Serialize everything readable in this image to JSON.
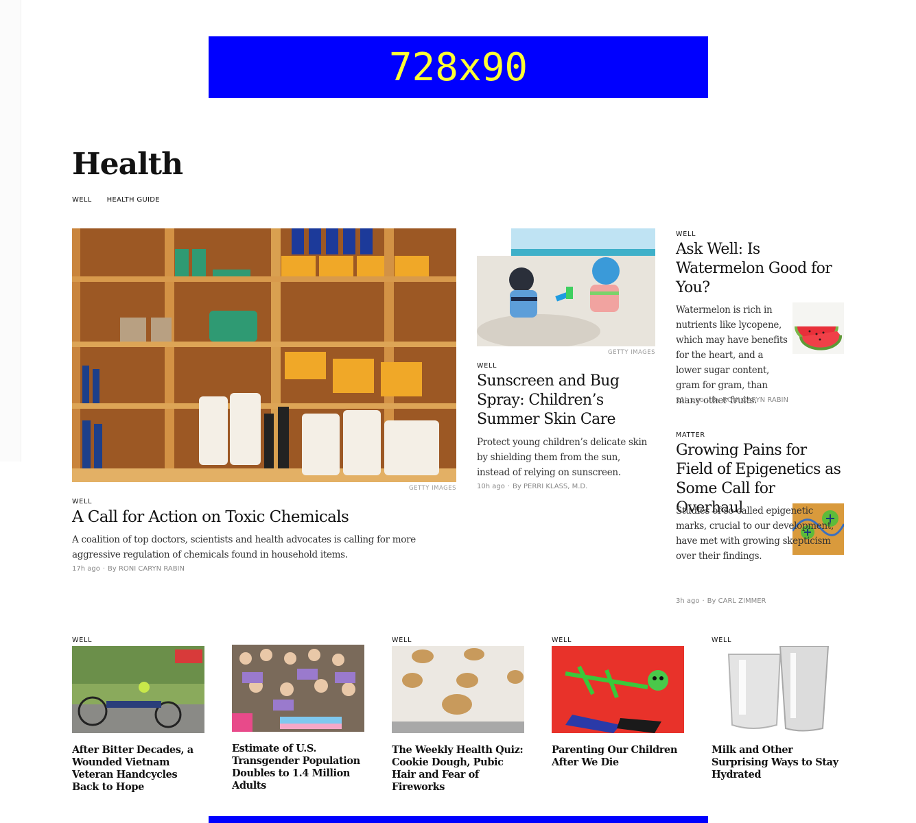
{
  "ads": {
    "top_label": "728x90"
  },
  "section": {
    "title": "Health",
    "subnav": [
      "WELL",
      "HEALTH GUIDE"
    ]
  },
  "lead": {
    "credit": "GETTY IMAGES",
    "kicker": "WELL",
    "headline": "A Call for Action on Toxic Chemicals",
    "summary": "A coalition of top doctors, scientists and health advocates is calling for more aggressive regulation of chemicals found in household items.",
    "time": "17h ago",
    "byline": "By RONI CARYN RABIN"
  },
  "middle": {
    "credit": "GETTY IMAGES",
    "kicker": "WELL",
    "headline": "Sunscreen and Bug Spray: Children’s Summer Skin Care",
    "summary": "Protect young children’s delicate skin by shielding them from the sun, instead of relying on sunscreen.",
    "time": "10h ago",
    "byline": "By PERRI KLASS, M.D."
  },
  "right1": {
    "kicker": "WELL",
    "headline": "Ask Well: Is Watermelon Good for You?",
    "summary": "Watermelon is rich in nutrients like lycopene, which may have benefits for the heart, and a lower sugar content, gram for gram, than many other fruits.",
    "time": "11h ago",
    "byline": "By RONI CARYN RABIN"
  },
  "right2": {
    "kicker": "MATTER",
    "headline": "Growing Pains for Field of Epigenetics as Some Call for Overhaul",
    "summary": "Studies of so-called epigenetic marks, crucial to our development, have met with growing skepticism over their findings.",
    "time": "3h ago",
    "byline": "By CARL ZIMMER"
  },
  "bottom": [
    {
      "kicker": "WELL",
      "headline": "After Bitter Decades, a Wounded Vietnam Veteran Handcycles Back to Hope"
    },
    {
      "kicker": "",
      "headline": "Estimate of U.S. Transgender Population Doubles to 1.4 Million Adults"
    },
    {
      "kicker": "WELL",
      "headline": "The Weekly Health Quiz: Cookie Dough, Pubic Hair and Fear of Fireworks"
    },
    {
      "kicker": "WELL",
      "headline": "Parenting Our Children After We Die"
    },
    {
      "kicker": "WELL",
      "headline": "Milk and Other Surprising Ways to Stay Hydrated"
    }
  ],
  "colors": {
    "ad_background": "#0000ff",
    "ad_text": "#ffff33",
    "text": "#121212",
    "byline": "#888888"
  }
}
